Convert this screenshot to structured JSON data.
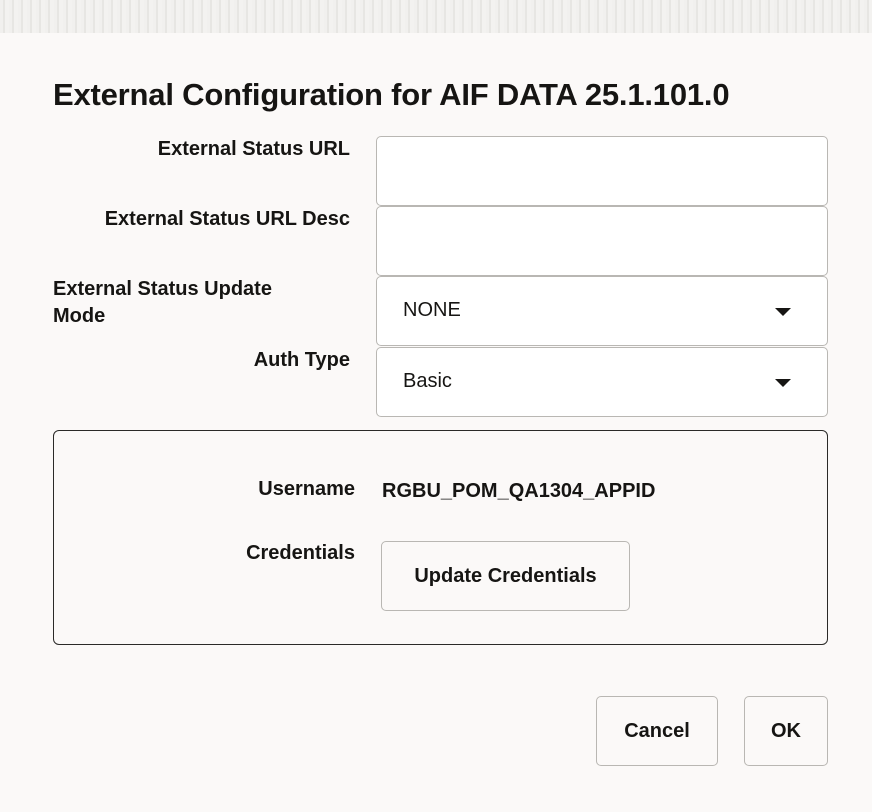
{
  "dialog": {
    "title": "External Configuration for AIF DATA 25.1.101.0"
  },
  "form": {
    "status_url_label": "External Status URL",
    "status_url_value": "",
    "status_url_desc_label": "External Status URL Desc",
    "status_url_desc_value": "",
    "update_mode_label_line1": "External Status Update",
    "update_mode_label_line2": "Mode",
    "update_mode_value": "NONE",
    "auth_type_label": "Auth Type",
    "auth_type_value": "Basic"
  },
  "auth": {
    "username_label": "Username",
    "username_value": "RGBU_POM_QA1304_APPID",
    "credentials_label": "Credentials",
    "update_credentials_label": "Update Credentials"
  },
  "footer": {
    "cancel_label": "Cancel",
    "ok_label": "OK"
  }
}
